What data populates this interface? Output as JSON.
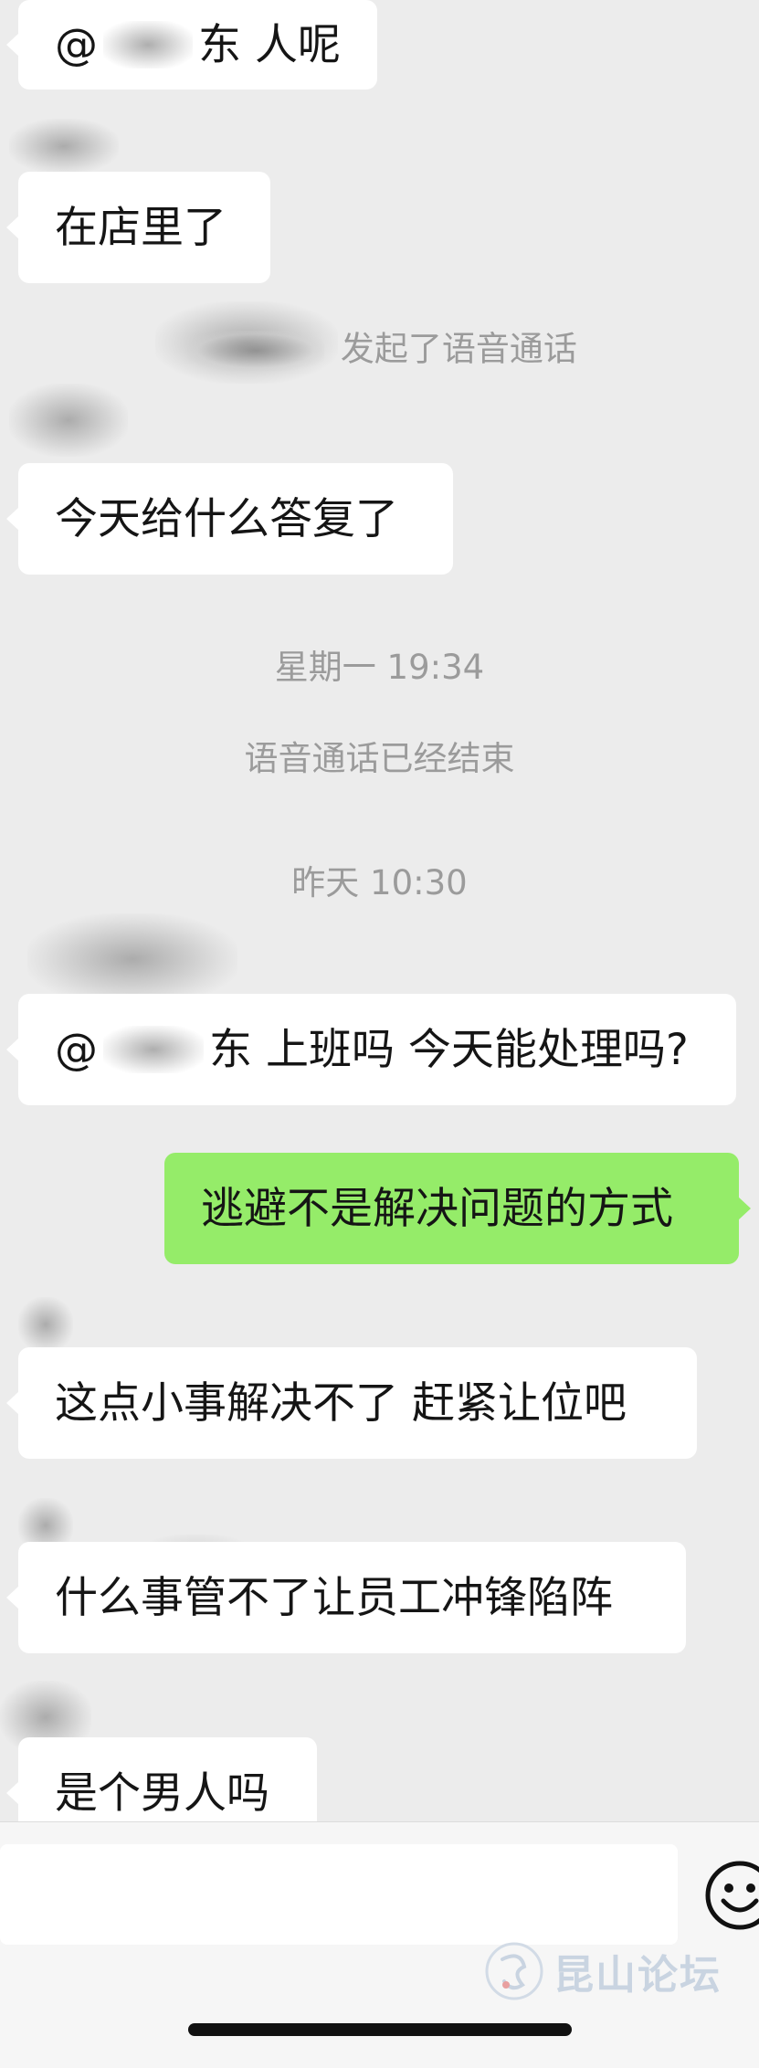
{
  "messages": {
    "m1": {
      "prefix": "@",
      "suffix": "东 人呢"
    },
    "m2": {
      "text": "在店里了"
    },
    "call_started": {
      "text": "发起了语音通话"
    },
    "m3": {
      "text": "今天给什么答复了"
    },
    "time1": {
      "text": "星期一 19:34"
    },
    "call_ended": {
      "text": "语音通话已经结束"
    },
    "time2": {
      "text": "昨天 10:30"
    },
    "m4": {
      "prefix": "@",
      "suffix": "东 上班吗 今天能处理吗?"
    },
    "m5": {
      "text": "逃避不是解决问题的方式"
    },
    "m6": {
      "text": "这点小事解决不了 赶紧让位吧"
    },
    "m7": {
      "text": "什么事管不了让员工冲锋陷阵"
    },
    "m8": {
      "text": "是个男人吗"
    }
  },
  "input_bar": {
    "emoji_icon": "smiley-face-icon"
  },
  "watermark": {
    "text": "昆山论坛"
  },
  "colors": {
    "background": "#ececec",
    "incoming_bubble": "#ffffff",
    "outgoing_bubble": "#95ec69",
    "system_text": "#9b9b9b"
  }
}
